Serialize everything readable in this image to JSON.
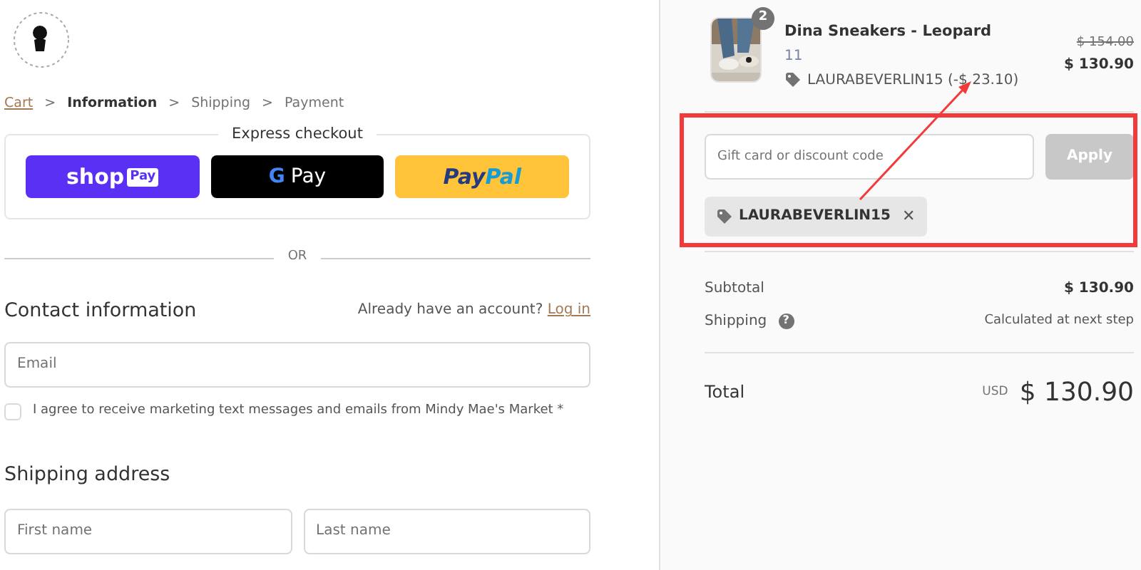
{
  "breadcrumb": [
    {
      "label": "Cart",
      "kind": "link"
    },
    {
      "label": "Information",
      "kind": "current"
    },
    {
      "label": "Shipping",
      "kind": "pending"
    },
    {
      "label": "Payment",
      "kind": "pending"
    }
  ],
  "separator": ">",
  "express_checkout": {
    "title": "Express checkout",
    "buttons": [
      {
        "kind": "shoppay",
        "parts": [
          "shop",
          "Pay"
        ]
      },
      {
        "kind": "gpay",
        "parts": [
          "G",
          "Pay"
        ]
      },
      {
        "kind": "paypal",
        "parts": [
          "Pay",
          "Pal"
        ]
      }
    ]
  },
  "divider_text": "OR",
  "contact": {
    "heading": "Contact information",
    "account_prompt": "Already have an account?",
    "login_link": "Log in",
    "email_placeholder": "Email",
    "marketing_label": "I agree to receive marketing text messages and emails from Mindy Mae's Market *",
    "marketing_checked": false
  },
  "shipping_address": {
    "heading": "Shipping address",
    "fields": [
      {
        "placeholder": "First name"
      },
      {
        "placeholder": "Last name"
      }
    ]
  },
  "order": {
    "items": [
      {
        "name": "Dina Sneakers - Leopard",
        "quantity": "2",
        "variant": "11",
        "discount": "LAURABEVERLIN15 (-$ 23.10)",
        "original_price": "$ 154.00",
        "price": "$ 130.90"
      }
    ],
    "discount_field": {
      "placeholder": "Gift card or discount code",
      "button": "Apply",
      "disabled": true
    },
    "applied_codes": [
      {
        "code": "LAURABEVERLIN15",
        "remove": "✕"
      }
    ],
    "subtotal": {
      "label": "Subtotal",
      "value": "$ 130.90"
    },
    "shipping": {
      "label": "Shipping",
      "value": "Calculated at next step",
      "help": "?"
    },
    "total": {
      "label": "Total",
      "currency": "USD",
      "value": "$ 130.90"
    }
  }
}
